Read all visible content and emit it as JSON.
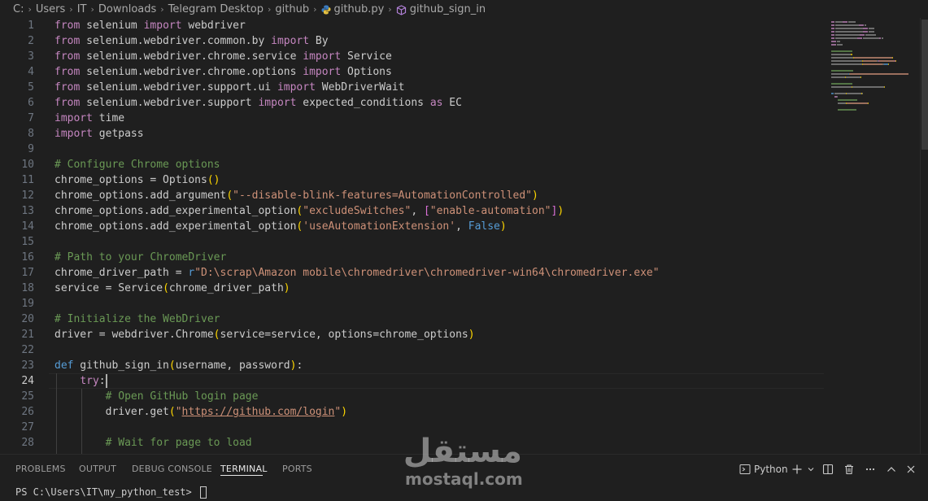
{
  "breadcrumb": {
    "items": [
      "C:",
      "Users",
      "IT",
      "Downloads",
      "Telegram Desktop",
      "github",
      "github.py",
      "github_sign_in"
    ],
    "separator": "›",
    "file_icon": "python-file-icon",
    "symbol_icon": "function-cube-icon"
  },
  "editor": {
    "language": "python",
    "active_line": 24,
    "line_numbers": [
      "1",
      "2",
      "3",
      "4",
      "5",
      "6",
      "7",
      "8",
      "9",
      "10",
      "11",
      "12",
      "13",
      "14",
      "15",
      "16",
      "17",
      "18",
      "19",
      "20",
      "21",
      "22",
      "23",
      "24",
      "25",
      "26",
      "27",
      "28"
    ],
    "lines": [
      [
        {
          "t": "from",
          "c": "kc"
        },
        {
          "t": " selenium "
        },
        {
          "t": "import",
          "c": "kc"
        },
        {
          "t": " webdriver"
        }
      ],
      [
        {
          "t": "from",
          "c": "kc"
        },
        {
          "t": " selenium.webdriver.common.by "
        },
        {
          "t": "import",
          "c": "kc"
        },
        {
          "t": " By"
        }
      ],
      [
        {
          "t": "from",
          "c": "kc"
        },
        {
          "t": " selenium.webdriver.chrome.service "
        },
        {
          "t": "import",
          "c": "kc"
        },
        {
          "t": " Service"
        }
      ],
      [
        {
          "t": "from",
          "c": "kc"
        },
        {
          "t": " selenium.webdriver.chrome.options "
        },
        {
          "t": "import",
          "c": "kc"
        },
        {
          "t": " Options"
        }
      ],
      [
        {
          "t": "from",
          "c": "kc"
        },
        {
          "t": " selenium.webdriver.support.ui "
        },
        {
          "t": "import",
          "c": "kc"
        },
        {
          "t": " WebDriverWait"
        }
      ],
      [
        {
          "t": "from",
          "c": "kc"
        },
        {
          "t": " selenium.webdriver.support "
        },
        {
          "t": "import",
          "c": "kc"
        },
        {
          "t": " expected_conditions "
        },
        {
          "t": "as",
          "c": "kc"
        },
        {
          "t": " EC"
        }
      ],
      [
        {
          "t": "import",
          "c": "kc"
        },
        {
          "t": " time"
        }
      ],
      [
        {
          "t": "import",
          "c": "kc"
        },
        {
          "t": " getpass"
        }
      ],
      [],
      [
        {
          "t": "# Configure Chrome options",
          "c": "cm"
        }
      ],
      [
        {
          "t": "chrome_options = Options"
        },
        {
          "t": "()",
          "c": "b1"
        }
      ],
      [
        {
          "t": "chrome_options.add_argument"
        },
        {
          "t": "(",
          "c": "b1"
        },
        {
          "t": "\"--disable-blink-features=AutomationControlled\"",
          "c": "str"
        },
        {
          "t": ")",
          "c": "b1"
        }
      ],
      [
        {
          "t": "chrome_options.add_experimental_option"
        },
        {
          "t": "(",
          "c": "b1"
        },
        {
          "t": "\"excludeSwitches\"",
          "c": "str"
        },
        {
          "t": ", "
        },
        {
          "t": "[",
          "c": "b2"
        },
        {
          "t": "\"enable-automation\"",
          "c": "str"
        },
        {
          "t": "]",
          "c": "b2"
        },
        {
          "t": ")",
          "c": "b1"
        }
      ],
      [
        {
          "t": "chrome_options.add_experimental_option"
        },
        {
          "t": "(",
          "c": "b1"
        },
        {
          "t": "'useAutomationExtension'",
          "c": "str"
        },
        {
          "t": ", "
        },
        {
          "t": "False",
          "c": "kw"
        },
        {
          "t": ")",
          "c": "b1"
        }
      ],
      [],
      [
        {
          "t": "# Path to your ChromeDriver",
          "c": "cm"
        }
      ],
      [
        {
          "t": "chrome_driver_path = "
        },
        {
          "t": "r",
          "c": "kw"
        },
        {
          "t": "\"D:\\scrap\\Amazon mobile\\chromedriver\\chromedriver-win64\\chromedriver.exe\"",
          "c": "str"
        }
      ],
      [
        {
          "t": "service = Service"
        },
        {
          "t": "(",
          "c": "b1"
        },
        {
          "t": "chrome_driver_path"
        },
        {
          "t": ")",
          "c": "b1"
        }
      ],
      [],
      [
        {
          "t": "# Initialize the WebDriver",
          "c": "cm"
        }
      ],
      [
        {
          "t": "driver = webdriver.Chrome"
        },
        {
          "t": "(",
          "c": "b1"
        },
        {
          "t": "service=service, options=chrome_options"
        },
        {
          "t": ")",
          "c": "b1"
        }
      ],
      [],
      [
        {
          "t": "def",
          "c": "kw"
        },
        {
          "t": " github_sign_in"
        },
        {
          "t": "(",
          "c": "b1"
        },
        {
          "t": "username, password"
        },
        {
          "t": ")",
          "c": "b1"
        },
        {
          "t": ":"
        }
      ],
      [
        {
          "t": "    "
        },
        {
          "t": "try",
          "c": "kc"
        },
        {
          "t": ":"
        }
      ],
      [
        {
          "t": "        "
        },
        {
          "t": "# Open GitHub login page",
          "c": "cm"
        }
      ],
      [
        {
          "t": "        driver.get"
        },
        {
          "t": "(",
          "c": "b1"
        },
        {
          "t": "\"",
          "c": "str"
        },
        {
          "t": "https://github.com/login",
          "c": "lnk"
        },
        {
          "t": "\"",
          "c": "str"
        },
        {
          "t": ")",
          "c": "b1"
        }
      ],
      [],
      [
        {
          "t": "        "
        },
        {
          "t": "# Wait for page to load",
          "c": "cm"
        }
      ]
    ]
  },
  "panel": {
    "tabs": [
      "PROBLEMS",
      "OUTPUT",
      "DEBUG CONSOLE",
      "TERMINAL",
      "PORTS"
    ],
    "active_tab": "TERMINAL",
    "terminal_profile": "Python",
    "actions": [
      "terminal-profile-icon",
      "add-terminal-icon",
      "chevron-down-icon",
      "split-terminal-icon",
      "trash-icon",
      "more-icon",
      "maximize-panel-icon",
      "close-icon"
    ]
  },
  "terminal": {
    "prompt": "PS C:\\Users\\IT\\my_python_test> "
  },
  "watermark": {
    "arabic": "مستقل",
    "latin": "mostaql.com"
  },
  "colors": {
    "background": "#1f1f1f",
    "keyword_blue": "#569cd6",
    "keyword_purple": "#c586c0",
    "string": "#ce9178",
    "comment": "#6a9955",
    "bracket_gold": "#ffd700",
    "bracket_orchid": "#da70d6"
  }
}
